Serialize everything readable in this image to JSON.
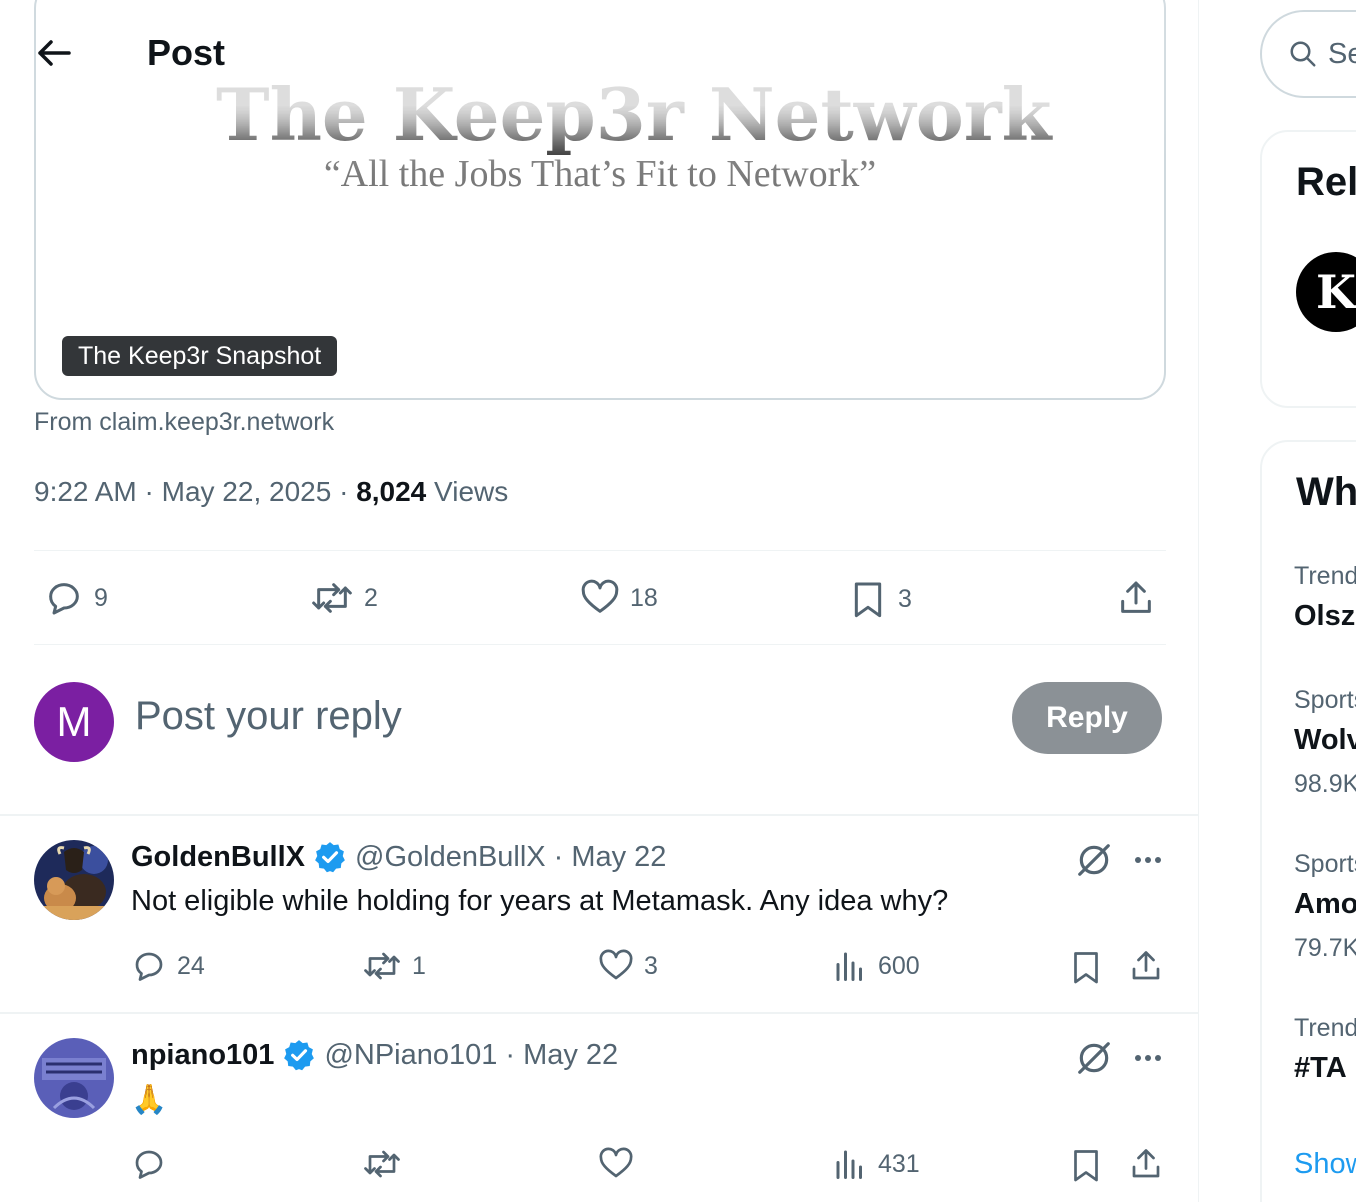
{
  "header": {
    "title": "Post",
    "back_icon": "arrow-left-icon"
  },
  "card": {
    "heading_tail": "The Keep3r Network",
    "tagline": "“All the Jobs That’s Fit to Network”",
    "label": "The Keep3r Snapshot"
  },
  "post": {
    "from": "From claim.keep3r.network",
    "time": "9:22 AM",
    "date": "May 22, 2025",
    "views_count": "8,024",
    "views_label": "Views",
    "stats": {
      "replies": "9",
      "reposts": "2",
      "likes": "18",
      "bookmarks": "3"
    }
  },
  "composer": {
    "avatar_letter": "M",
    "placeholder": "Post your reply",
    "button_label": "Reply",
    "avatar_color": "#7b1fa2"
  },
  "replies": [
    {
      "name": "GoldenBullX",
      "handle": "@GoldenBullX",
      "separator": "·",
      "date": "May 22",
      "text": "Not eligible while holding for years at Metamask. Any idea why?",
      "stats": {
        "replies": "24",
        "reposts": "1",
        "likes": "3",
        "views": "600"
      }
    },
    {
      "name": "npiano101",
      "handle": "@NPiano101",
      "separator": "·",
      "date": "May 22",
      "text": "🙏",
      "stats": {
        "replies": "",
        "reposts": "",
        "likes": "",
        "views": "431"
      }
    }
  ],
  "sidebar": {
    "search_placeholder": "Search",
    "relevant_title": "Relevant people",
    "relevant_avatar_letter": "K",
    "whats_happening_title": "What’s happening",
    "trends": [
      {
        "category": "Trending",
        "name": "Olsz",
        "count": ""
      },
      {
        "category": "Sports",
        "name": "Wolv",
        "count": "98.9K"
      },
      {
        "category": "Sports",
        "name": "Amo",
        "count": "79.7K"
      },
      {
        "category": "Trending",
        "name": "#TA",
        "count": ""
      }
    ],
    "show_more": "Show more"
  },
  "colors": {
    "accent": "#1d9bf0",
    "text_secondary": "#536471",
    "verified": "#1d9bf0"
  }
}
